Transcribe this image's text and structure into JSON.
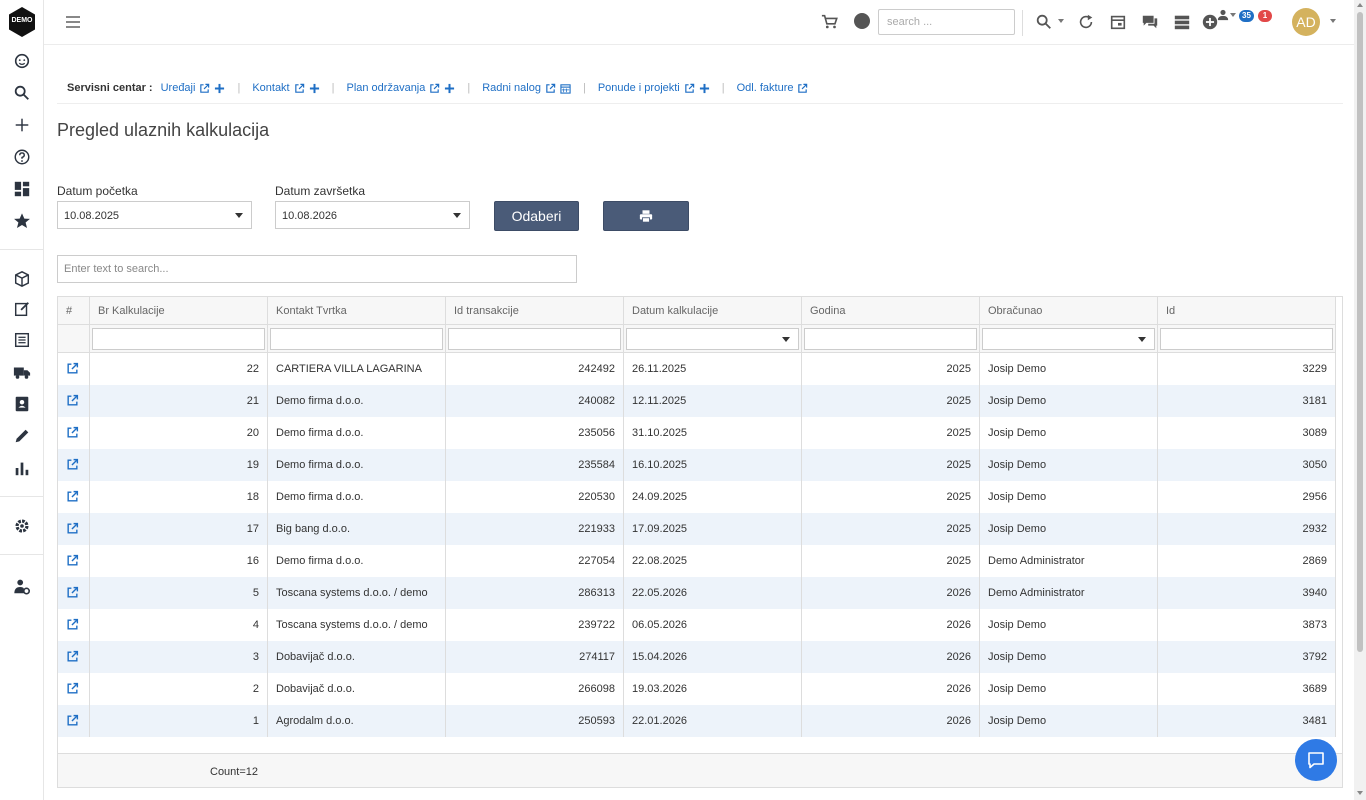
{
  "logo": {
    "text": "DEMO"
  },
  "topbar": {
    "search_placeholder": "search ...",
    "notifications_count": "35",
    "alerts_count": "1",
    "avatar_initials": "AD"
  },
  "service_nav": {
    "label": "Servisni centar :",
    "links": [
      {
        "label": "Uređaji"
      },
      {
        "label": "Kontakt"
      },
      {
        "label": "Plan održavanja"
      },
      {
        "label": "Radni nalog"
      },
      {
        "label": "Ponude i projekti"
      },
      {
        "label": "Odl. fakture"
      }
    ],
    "separator": "|"
  },
  "page": {
    "title": "Pregled ulaznih kalkulacija",
    "start_label": "Datum početka",
    "start_value": "10.08.2025",
    "end_label": "Datum završetka",
    "end_value": "10.08.2026",
    "select_button": "Odaberi",
    "grid_search_placeholder": "Enter text to search..."
  },
  "grid": {
    "columns": [
      "#",
      "Br Kalkulacije",
      "Kontakt Tvrtka",
      "Id transakcije",
      "Datum kalkulacije",
      "Godina",
      "Obračunao",
      "Id"
    ],
    "rows": [
      [
        "22",
        "CARTIERA VILLA LAGARINA",
        "242492",
        "26.11.2025",
        "2025",
        "Josip Demo",
        "3229"
      ],
      [
        "21",
        "Demo firma d.o.o.",
        "240082",
        "12.11.2025",
        "2025",
        "Josip Demo",
        "3181"
      ],
      [
        "20",
        "Demo firma d.o.o.",
        "235056",
        "31.10.2025",
        "2025",
        "Josip Demo",
        "3089"
      ],
      [
        "19",
        "Demo firma d.o.o.",
        "235584",
        "16.10.2025",
        "2025",
        "Josip Demo",
        "3050"
      ],
      [
        "18",
        "Demo firma d.o.o.",
        "220530",
        "24.09.2025",
        "2025",
        "Josip Demo",
        "2956"
      ],
      [
        "17",
        "Big bang d.o.o.",
        "221933",
        "17.09.2025",
        "2025",
        "Josip Demo",
        "2932"
      ],
      [
        "16",
        "Demo firma d.o.o.",
        "227054",
        "22.08.2025",
        "2025",
        "Demo Administrator",
        "2869"
      ],
      [
        "5",
        "Toscana systems d.o.o. / demo",
        "286313",
        "22.05.2026",
        "2026",
        "Demo Administrator",
        "3940"
      ],
      [
        "4",
        "Toscana systems d.o.o. / demo",
        "239722",
        "06.05.2026",
        "2026",
        "Josip Demo",
        "3873"
      ],
      [
        "3",
        "Dobavijač d.o.o.",
        "274117",
        "15.04.2026",
        "2026",
        "Josip Demo",
        "3792"
      ],
      [
        "2",
        "Dobavijač d.o.o.",
        "266098",
        "19.03.2026",
        "2026",
        "Josip Demo",
        "3689"
      ],
      [
        "1",
        "Agrodalm d.o.o.",
        "250593",
        "22.01.2026",
        "2026",
        "Josip Demo",
        "3481"
      ]
    ],
    "count": "Count=12"
  }
}
